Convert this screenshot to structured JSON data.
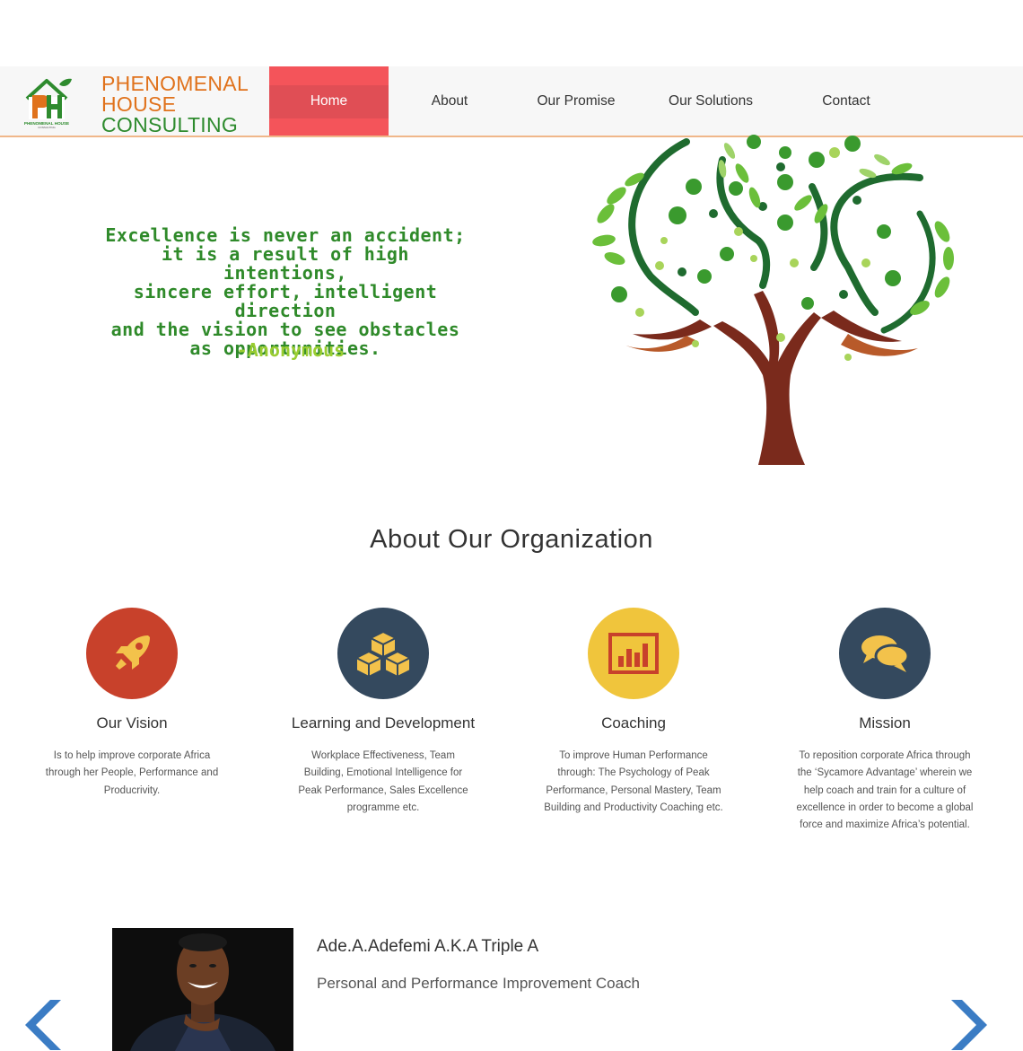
{
  "brand": {
    "line1": "PHENOMENAL",
    "line2": "HOUSE",
    "line3": "CONSULTING",
    "line1_color": "#e0721c",
    "line2_color": "#e0721c",
    "line3_color": "#2e8b2e"
  },
  "nav": {
    "items": [
      {
        "label": "Home",
        "active": true
      },
      {
        "label": "About"
      },
      {
        "label": "Our Promise"
      },
      {
        "label": "Our Solutions"
      },
      {
        "label": "Contact"
      }
    ],
    "active_color": "#f4545a"
  },
  "hero": {
    "quote_lines": [
      "Excellence is never an accident;",
      "it is a result of high intentions,",
      "sincere effort, intelligent direction",
      "and the vision to see obstacles",
      "as opportunities."
    ],
    "author": "-Anonymous"
  },
  "about": {
    "title": "About Our Organization",
    "features": [
      {
        "title": "Our Vision",
        "icon": "rocket-icon",
        "color": "#c8412b",
        "desc": "Is to help improve corporate Africa through her People, Performance and Producrivity."
      },
      {
        "title": "Learning and Development",
        "icon": "cubes-icon",
        "color": "#34495e",
        "desc": "Workplace Effectiveness, Team Building, Emotional Intelligence for Peak Performance, Sales Excellence programme etc."
      },
      {
        "title": "Coaching",
        "icon": "bar-chart-icon",
        "color": "#f0c53c",
        "desc": "To improve Human Performance through: The Psychology of Peak Performance, Personal Mastery, Team Building and Productivity Coaching etc."
      },
      {
        "title": "Mission",
        "icon": "chat-bubbles-icon",
        "color": "#34495e",
        "desc": "To reposition corporate Africa through the ‘Sycamore Advantage’ wherein we help coach and train for a culture of excellence in order to become a global force and maximize Africa’s potential."
      }
    ]
  },
  "profile": {
    "name": "Ade.A.Adefemi A.K.A Triple A",
    "role": "Personal and Performance Improvement Coach"
  }
}
